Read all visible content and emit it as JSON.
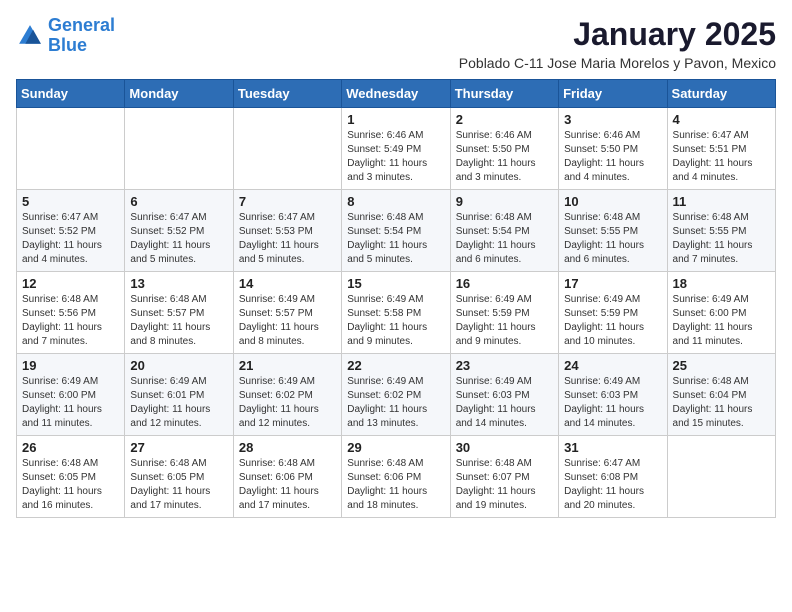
{
  "header": {
    "logo_line1": "General",
    "logo_line2": "Blue",
    "month_title": "January 2025",
    "location": "Poblado C-11 Jose Maria Morelos y Pavon, Mexico"
  },
  "weekdays": [
    "Sunday",
    "Monday",
    "Tuesday",
    "Wednesday",
    "Thursday",
    "Friday",
    "Saturday"
  ],
  "weeks": [
    [
      {
        "day": "",
        "info": ""
      },
      {
        "day": "",
        "info": ""
      },
      {
        "day": "",
        "info": ""
      },
      {
        "day": "1",
        "info": "Sunrise: 6:46 AM\nSunset: 5:49 PM\nDaylight: 11 hours\nand 3 minutes."
      },
      {
        "day": "2",
        "info": "Sunrise: 6:46 AM\nSunset: 5:50 PM\nDaylight: 11 hours\nand 3 minutes."
      },
      {
        "day": "3",
        "info": "Sunrise: 6:46 AM\nSunset: 5:50 PM\nDaylight: 11 hours\nand 4 minutes."
      },
      {
        "day": "4",
        "info": "Sunrise: 6:47 AM\nSunset: 5:51 PM\nDaylight: 11 hours\nand 4 minutes."
      }
    ],
    [
      {
        "day": "5",
        "info": "Sunrise: 6:47 AM\nSunset: 5:52 PM\nDaylight: 11 hours\nand 4 minutes."
      },
      {
        "day": "6",
        "info": "Sunrise: 6:47 AM\nSunset: 5:52 PM\nDaylight: 11 hours\nand 5 minutes."
      },
      {
        "day": "7",
        "info": "Sunrise: 6:47 AM\nSunset: 5:53 PM\nDaylight: 11 hours\nand 5 minutes."
      },
      {
        "day": "8",
        "info": "Sunrise: 6:48 AM\nSunset: 5:54 PM\nDaylight: 11 hours\nand 5 minutes."
      },
      {
        "day": "9",
        "info": "Sunrise: 6:48 AM\nSunset: 5:54 PM\nDaylight: 11 hours\nand 6 minutes."
      },
      {
        "day": "10",
        "info": "Sunrise: 6:48 AM\nSunset: 5:55 PM\nDaylight: 11 hours\nand 6 minutes."
      },
      {
        "day": "11",
        "info": "Sunrise: 6:48 AM\nSunset: 5:55 PM\nDaylight: 11 hours\nand 7 minutes."
      }
    ],
    [
      {
        "day": "12",
        "info": "Sunrise: 6:48 AM\nSunset: 5:56 PM\nDaylight: 11 hours\nand 7 minutes."
      },
      {
        "day": "13",
        "info": "Sunrise: 6:48 AM\nSunset: 5:57 PM\nDaylight: 11 hours\nand 8 minutes."
      },
      {
        "day": "14",
        "info": "Sunrise: 6:49 AM\nSunset: 5:57 PM\nDaylight: 11 hours\nand 8 minutes."
      },
      {
        "day": "15",
        "info": "Sunrise: 6:49 AM\nSunset: 5:58 PM\nDaylight: 11 hours\nand 9 minutes."
      },
      {
        "day": "16",
        "info": "Sunrise: 6:49 AM\nSunset: 5:59 PM\nDaylight: 11 hours\nand 9 minutes."
      },
      {
        "day": "17",
        "info": "Sunrise: 6:49 AM\nSunset: 5:59 PM\nDaylight: 11 hours\nand 10 minutes."
      },
      {
        "day": "18",
        "info": "Sunrise: 6:49 AM\nSunset: 6:00 PM\nDaylight: 11 hours\nand 11 minutes."
      }
    ],
    [
      {
        "day": "19",
        "info": "Sunrise: 6:49 AM\nSunset: 6:00 PM\nDaylight: 11 hours\nand 11 minutes."
      },
      {
        "day": "20",
        "info": "Sunrise: 6:49 AM\nSunset: 6:01 PM\nDaylight: 11 hours\nand 12 minutes."
      },
      {
        "day": "21",
        "info": "Sunrise: 6:49 AM\nSunset: 6:02 PM\nDaylight: 11 hours\nand 12 minutes."
      },
      {
        "day": "22",
        "info": "Sunrise: 6:49 AM\nSunset: 6:02 PM\nDaylight: 11 hours\nand 13 minutes."
      },
      {
        "day": "23",
        "info": "Sunrise: 6:49 AM\nSunset: 6:03 PM\nDaylight: 11 hours\nand 14 minutes."
      },
      {
        "day": "24",
        "info": "Sunrise: 6:49 AM\nSunset: 6:03 PM\nDaylight: 11 hours\nand 14 minutes."
      },
      {
        "day": "25",
        "info": "Sunrise: 6:48 AM\nSunset: 6:04 PM\nDaylight: 11 hours\nand 15 minutes."
      }
    ],
    [
      {
        "day": "26",
        "info": "Sunrise: 6:48 AM\nSunset: 6:05 PM\nDaylight: 11 hours\nand 16 minutes."
      },
      {
        "day": "27",
        "info": "Sunrise: 6:48 AM\nSunset: 6:05 PM\nDaylight: 11 hours\nand 17 minutes."
      },
      {
        "day": "28",
        "info": "Sunrise: 6:48 AM\nSunset: 6:06 PM\nDaylight: 11 hours\nand 17 minutes."
      },
      {
        "day": "29",
        "info": "Sunrise: 6:48 AM\nSunset: 6:06 PM\nDaylight: 11 hours\nand 18 minutes."
      },
      {
        "day": "30",
        "info": "Sunrise: 6:48 AM\nSunset: 6:07 PM\nDaylight: 11 hours\nand 19 minutes."
      },
      {
        "day": "31",
        "info": "Sunrise: 6:47 AM\nSunset: 6:08 PM\nDaylight: 11 hours\nand 20 minutes."
      },
      {
        "day": "",
        "info": ""
      }
    ]
  ]
}
